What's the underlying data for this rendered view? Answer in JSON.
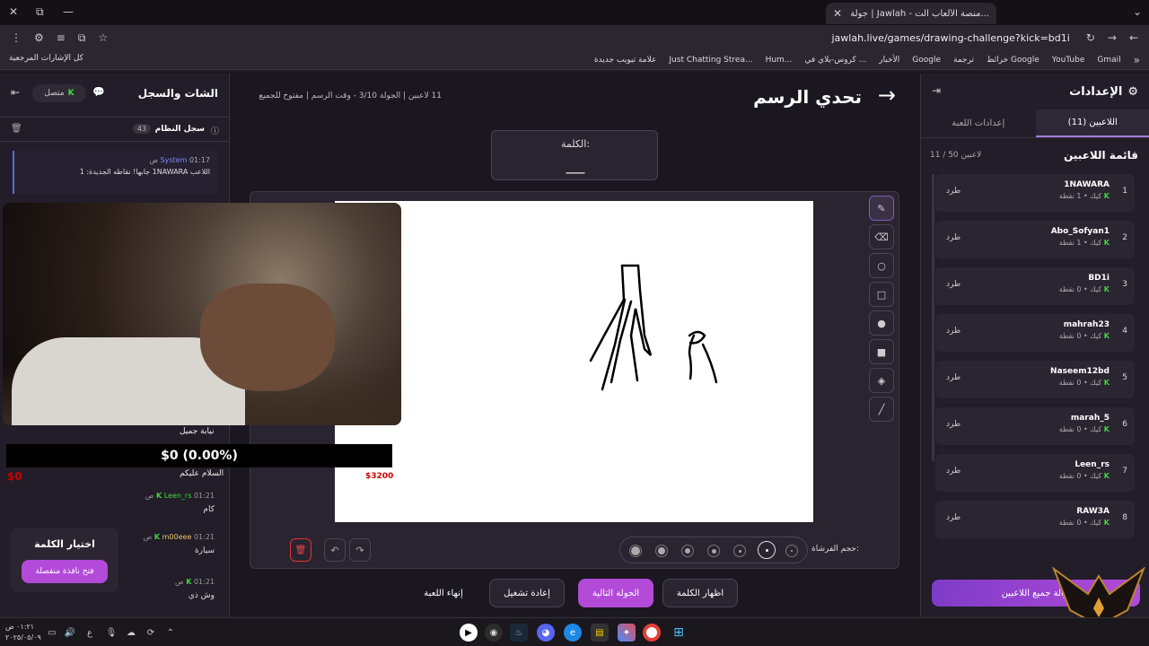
{
  "browser": {
    "tab_title": "جولة | Jawlah - منصة الألعاب الت...",
    "url": "jawlah.live/games/drawing-challenge?kick=bd1i",
    "bookmarks": [
      "Gmail",
      "YouTube",
      "خرائط Google",
      "ترجمة",
      "Google",
      "الأخبار",
      "كروس-بلاي في ...",
      "Hum...",
      "Just Chatting Strea...",
      "علامة تبويب جديدة"
    ],
    "bookmarks_left": "كل الإشارات المرجعية"
  },
  "settings": {
    "title": "الإعدادات",
    "tabs": [
      {
        "label": "اللاعبين (11)",
        "active": true
      },
      {
        "label": "إعدادات اللعبة",
        "active": false
      }
    ],
    "players_title": "قائمة اللاعبين",
    "players_count": "11 / 50 لاعبين",
    "kick_label": "طرد",
    "players": [
      {
        "num": "1",
        "name": "1NAWARA",
        "sub": "كيك • 1 نقطة"
      },
      {
        "num": "2",
        "name": "Abo_Sofyan1",
        "sub": "كيك • 1 نقطة"
      },
      {
        "num": "3",
        "name": "BD1i",
        "sub": "كيك • 0 نقطة"
      },
      {
        "num": "4",
        "name": "mahrah23",
        "sub": "كيك • 0 نقطة"
      },
      {
        "num": "5",
        "name": "Naseem12bd",
        "sub": "كيك • 0 نقطة"
      },
      {
        "num": "6",
        "name": "marah_5",
        "sub": "كيك • 0 نقطة"
      },
      {
        "num": "7",
        "name": "Leen_rs",
        "sub": "كيك • 0 نقطة"
      },
      {
        "num": "8",
        "name": "RAW3A",
        "sub": "كيك • 0 نقطة"
      }
    ],
    "kick_all": "إزالة جميع اللاعبين"
  },
  "chat": {
    "title": "الشات والسجل",
    "status": "متصل",
    "syslog_title": "سجل النظام",
    "syslog_count": "43",
    "system_msg": {
      "name": "System",
      "time": "01:17 ص",
      "text": "اللاعب 1NAWARA جابها! نقاطه الجديدة: 1"
    },
    "messages": [
      {
        "name": "Leen_rs",
        "time": "01:21 ص",
        "text": "كام",
        "color": "#3cdc3c"
      },
      {
        "name": "m00eee",
        "time": "01:21 ص",
        "text": "سيارة",
        "color": "#e8c86a"
      },
      {
        "name": "",
        "time": "01:21 ص",
        "text": "وش ذي",
        "color": "#c05a7a"
      }
    ],
    "overlay_msgs": [
      "نيابة جميل",
      "السلام عليكم"
    ],
    "pick_word_title": "اختيار الكلمة",
    "pick_word_btn": "فتح نافذة منفصلة"
  },
  "game": {
    "title": "تحدي الرسم",
    "meta": "11 لاعبين | الجولة 3/10 - وقت الرسم | مفتوح للجميع",
    "word_label": "الكلمة:",
    "word_blank": "___",
    "brush_label": "حجم الفرشاة:",
    "buttons": {
      "show_word": "اظهار الكلمة",
      "next_round": "الجولة التالية",
      "restart": "إعادة تشغيل",
      "end_game": "إنهاء اللعبة"
    }
  },
  "stream_overlay": {
    "donation": "$0 (0.00%)",
    "left_amount": "$0",
    "right_amount": "$3200"
  },
  "taskbar": {
    "time": "٠١:٢١ ص",
    "date": "٢٠٢٥/٠٥/٠٩"
  }
}
